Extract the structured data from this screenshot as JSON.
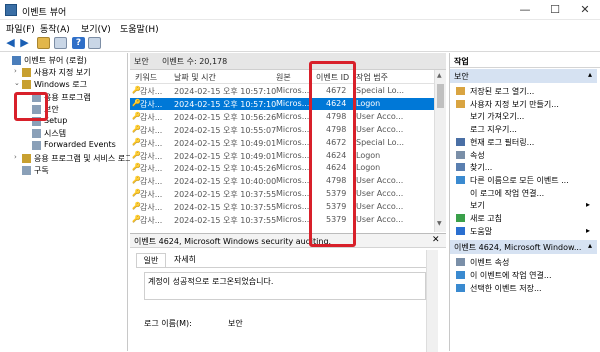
{
  "window": {
    "title": "이벤트 뷰어",
    "minimize": "—",
    "maximize": "☐",
    "close": "✕"
  },
  "menu": [
    "파일(F)",
    "동작(A)",
    "보기(V)",
    "도움말(H)"
  ],
  "tree": [
    {
      "label": "이벤트 뷰어 (로컬)",
      "lvl": 0,
      "tw": "",
      "ic": "#4a7ebb"
    },
    {
      "label": "사용자 지정 보기",
      "lvl": 1,
      "tw": "›",
      "ic": "#c8a030"
    },
    {
      "label": "Windows 로그",
      "lvl": 1,
      "tw": "⌄",
      "ic": "#c8a030"
    },
    {
      "label": "응용 프로그램",
      "lvl": 2,
      "tw": "",
      "ic": "#8aa0b8"
    },
    {
      "label": "보안",
      "lvl": 2,
      "tw": "",
      "ic": "#8aa0b8"
    },
    {
      "label": "Setup",
      "lvl": 2,
      "tw": "",
      "ic": "#8aa0b8"
    },
    {
      "label": "시스템",
      "lvl": 2,
      "tw": "",
      "ic": "#8aa0b8"
    },
    {
      "label": "Forwarded Events",
      "lvl": 2,
      "tw": "",
      "ic": "#8aa0b8"
    },
    {
      "label": "응용 프로그램 및 서비스 로그",
      "lvl": 1,
      "tw": "›",
      "ic": "#c8a030"
    },
    {
      "label": "구독",
      "lvl": 1,
      "tw": "",
      "ic": "#8aa0b8"
    }
  ],
  "center": {
    "log_name": "보안",
    "event_count": "이벤트 수: 20,178",
    "columns": [
      "키워드",
      "날짜 및 시간",
      "원본",
      "이벤트 ID",
      "작업 범주"
    ],
    "rows": [
      {
        "kw": "감사...",
        "dt": "2024-02-15 오후 10:57:10",
        "src": "Micros...",
        "id": "4672",
        "cat": "Special Lo..."
      },
      {
        "kw": "감사...",
        "dt": "2024-02-15 오후 10:57:10",
        "src": "Micros...",
        "id": "4624",
        "cat": "Logon"
      },
      {
        "kw": "감사...",
        "dt": "2024-02-15 오후 10:56:26",
        "src": "Micros...",
        "id": "4798",
        "cat": "User Acco..."
      },
      {
        "kw": "감사...",
        "dt": "2024-02-15 오후 10:55:07",
        "src": "Micros...",
        "id": "4798",
        "cat": "User Acco..."
      },
      {
        "kw": "감사...",
        "dt": "2024-02-15 오후 10:49:01",
        "src": "Micros...",
        "id": "4672",
        "cat": "Special Lo..."
      },
      {
        "kw": "감사...",
        "dt": "2024-02-15 오후 10:49:01",
        "src": "Micros...",
        "id": "4624",
        "cat": "Logon"
      },
      {
        "kw": "감사...",
        "dt": "2024-02-15 오후 10:45:26",
        "src": "Micros...",
        "id": "4624",
        "cat": "Logon"
      },
      {
        "kw": "감사...",
        "dt": "2024-02-15 오후 10:40:00",
        "src": "Micros...",
        "id": "4798",
        "cat": "User Acco..."
      },
      {
        "kw": "감사...",
        "dt": "2024-02-15 오후 10:37:55",
        "src": "Micros...",
        "id": "5379",
        "cat": "User Acco..."
      },
      {
        "kw": "감사...",
        "dt": "2024-02-15 오후 10:37:55",
        "src": "Micros...",
        "id": "5379",
        "cat": "User Acco..."
      },
      {
        "kw": "감사...",
        "dt": "2024-02-15 오후 10:37:55",
        "src": "Micros...",
        "id": "5379",
        "cat": "User Acco..."
      }
    ],
    "selected_index": 1,
    "detail_title": "이벤트 4624, Microsoft Windows security auditing.",
    "tabs": [
      "일반",
      "자세히"
    ],
    "detail_text": "계정이 성공적으로 로그온되었습니다.",
    "field_label": "로그 이름(M):",
    "field_value": "보안"
  },
  "actions": {
    "header": "작업",
    "section1": "보안",
    "items1": [
      {
        "label": "저장된 로그 열기...",
        "ic": "#d9a441",
        "arrow": ""
      },
      {
        "label": "사용자 지정 보기 만들기...",
        "ic": "#d9a441",
        "arrow": ""
      },
      {
        "label": "보기 가져오기...",
        "ic": "",
        "arrow": ""
      },
      {
        "label": "로그 지우기...",
        "ic": "",
        "arrow": ""
      },
      {
        "label": "현재 로그 필터링...",
        "ic": "#4a6fa5",
        "arrow": ""
      },
      {
        "label": "속성",
        "ic": "#7a8fa8",
        "arrow": ""
      },
      {
        "label": "찾기...",
        "ic": "#5a7fb0",
        "arrow": ""
      },
      {
        "label": "다른 이름으로 모든 이벤트 ...",
        "ic": "#3a8ad0",
        "arrow": ""
      },
      {
        "label": "이 로그에 작업 연결...",
        "ic": "",
        "arrow": ""
      },
      {
        "label": "보기",
        "ic": "",
        "arrow": "▸"
      },
      {
        "label": "새로 고침",
        "ic": "#3aa04a",
        "arrow": ""
      },
      {
        "label": "도움말",
        "ic": "#2a6fd0",
        "arrow": "▸"
      }
    ],
    "section2": "이벤트 4624, Microsoft Window...",
    "items2": [
      {
        "label": "이벤트 속성",
        "ic": "#7a8fa8",
        "arrow": ""
      },
      {
        "label": "이 이벤트에 작업 연결...",
        "ic": "#3a8ad0",
        "arrow": ""
      },
      {
        "label": "선택한 이벤트 저장...",
        "ic": "#3a8ad0",
        "arrow": ""
      }
    ]
  },
  "accent": "#0078d7",
  "highlight": "#d8202a"
}
